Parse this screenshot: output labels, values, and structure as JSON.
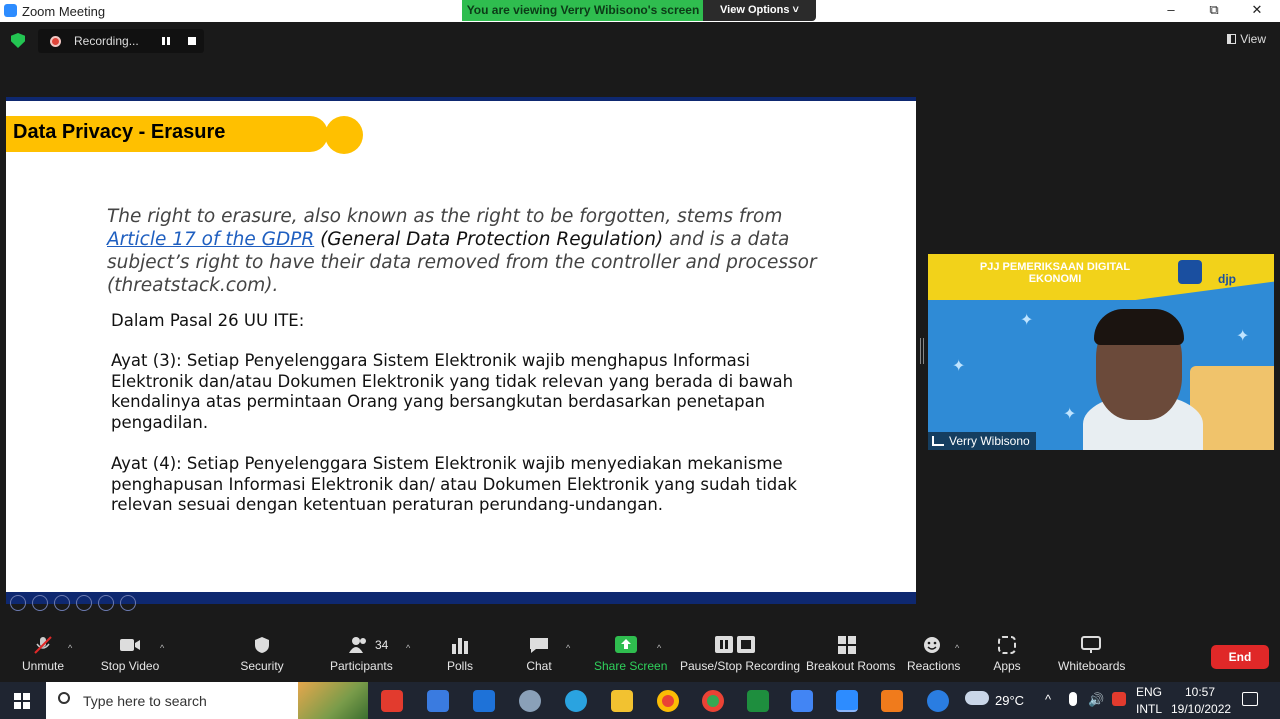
{
  "window": {
    "title": "Zoom Meeting",
    "minimize": "–",
    "restore": "⧉",
    "close": "✕"
  },
  "share_banner": {
    "text": "You are viewing Verry Wibisono's screen",
    "view_options": "View Options ˅"
  },
  "recording": {
    "label": "Recording..."
  },
  "view_button": "View",
  "slide": {
    "title": "Data Privacy - Erasure",
    "quote_part1": "The right to erasure, also known as the right to be forgotten, stems from ",
    "quote_link": "Article 17 of the GDPR",
    "quote_part2": " (General Data Protection Regulation)",
    "quote_part3": "  and is a data subject’s right to have their data removed from the controller and processor (threatstack.com).",
    "pasal": "Dalam Pasal 26 UU ITE:",
    "ayat3": "Ayat (3): Setiap Penyelenggara Sistem Elektronik wajib menghapus Informasi Elektronik dan/atau Dokumen Elektronik yang tidak relevan yang berada di bawah kendalinya atas permintaan Orang yang bersangkutan berdasarkan penetapan pengadilan.",
    "ayat4": "Ayat (4): Setiap Penyelenggara Sistem Elektronik wajib menyediakan mekanisme penghapusan Informasi Elektronik dan/ atau Dokumen Elektronik yang sudah tidak relevan sesuai dengan ketentuan peraturan perundang-undangan."
  },
  "video": {
    "banner": "PJJ PEMERIKSAAN DIGITAL EKONOMI",
    "logo_text": "djp",
    "participant_name": "Verry Wibisono"
  },
  "toolbar": {
    "unmute": "Unmute",
    "stop_video": "Stop Video",
    "security": "Security",
    "participants": "Participants",
    "participants_count": "34",
    "polls": "Polls",
    "chat": "Chat",
    "share_screen": "Share Screen",
    "pause_recording": "Pause/Stop Recording",
    "breakout_rooms": "Breakout Rooms",
    "reactions": "Reactions",
    "apps": "Apps",
    "whiteboards": "Whiteboards",
    "end": "End"
  },
  "taskbar": {
    "search_placeholder": "Type here to search",
    "weather": "29°C",
    "lang1": "ENG",
    "lang2": "INTL",
    "time": "10:57",
    "date": "19/10/2022"
  },
  "colors": {
    "share_green": "#2fbd4f",
    "slide_yellow": "#ffc000",
    "slide_navy": "#0e2870",
    "end_red": "#e02828"
  }
}
